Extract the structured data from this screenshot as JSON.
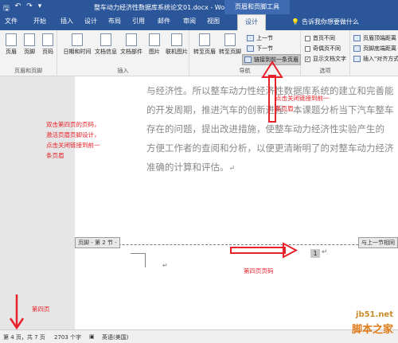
{
  "app": {
    "title": "整车动力经济性数据库系统论文01.docx - Word",
    "context_title": "页眉和页脚工具"
  },
  "tabs": [
    {
      "label": "文件"
    },
    {
      "label": "开始"
    },
    {
      "label": "插入"
    },
    {
      "label": "设计"
    },
    {
      "label": "布局"
    },
    {
      "label": "引用"
    },
    {
      "label": "邮件"
    },
    {
      "label": "审阅"
    },
    {
      "label": "视图"
    },
    {
      "label": "设计"
    }
  ],
  "tell_me": "告诉我你想要做什么",
  "ribbon": {
    "header_footer": {
      "label": "页眉和页脚",
      "header": "页眉",
      "footer": "页脚",
      "page_number": "页码"
    },
    "insert": {
      "label": "插入",
      "date_time": "日期和时间",
      "doc_info": "文档信息",
      "doc_parts": "文档部件",
      "pictures": "图片",
      "online_pictures": "联机图片"
    },
    "navigation": {
      "label": "导航",
      "goto_header": "转至页眉",
      "goto_footer": "转至页脚",
      "previous": "上一节",
      "next": "下一节",
      "link_previous": "链接到前一条页眉"
    },
    "options": {
      "label": "选项",
      "different_first": "首页不同",
      "different_odd_even": "奇偶页不同",
      "show_doc_text": "显示文档文字"
    },
    "position": {
      "header_from_top": "页眉顶端距离",
      "footer_from_bottom": "页脚底端距离",
      "insert_alignment_tab": "插入\"对齐方式\"选项卡"
    }
  },
  "document": {
    "body_lines": [
      "与经济性。所以整车动力性经济性数据库系统的建立和完善能",
      "的开发周期，推进汽车的创新进程。本课题分析当下汽车整车",
      "存在的问题，提出改进措施，使整车动力经济性实验产生的",
      "方便工作者的查阅和分析，以便更清晰明了的对整车动力经济",
      "准确的计算和评估。"
    ],
    "paragraph_mark": "↵",
    "footer_tag": "页脚 - 第 2 节 -",
    "same_as_previous": "与上一节相同",
    "page_number": "1"
  },
  "annotations": {
    "left_note": "双击第四页的页码，\n激活页眉页脚设计，\n点击关闭链接到前一\n条页眉",
    "top_note": "点击关闭链接到前一\n条页眉",
    "page_num_note": "第四页页码",
    "page_four_note": "第四页"
  },
  "status": {
    "page": "第 4 页，共 7 页",
    "words": "2703 个字",
    "language": "英语(美国)"
  },
  "watermark": {
    "domain": "jb51.net",
    "site": "脚本之家"
  },
  "colors": {
    "ribbon_blue": "#2b579a",
    "annotation_red": "#e8222a"
  }
}
